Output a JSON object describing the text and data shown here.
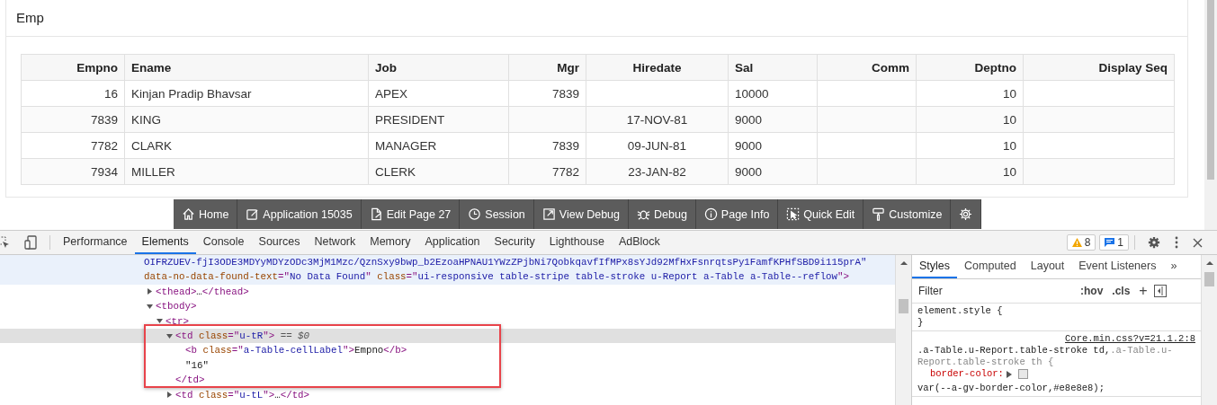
{
  "region": {
    "title": "Emp"
  },
  "table": {
    "columns": [
      "Empno",
      "Ename",
      "Job",
      "Mgr",
      "Hiredate",
      "Sal",
      "Comm",
      "Deptno",
      "Display Seq"
    ],
    "rows": [
      [
        "16",
        "Kinjan Pradip Bhavsar",
        "APEX",
        "7839",
        "",
        "10000",
        "",
        "10",
        ""
      ],
      [
        "7839",
        "KING",
        "PRESIDENT",
        "",
        "17-NOV-81",
        "9000",
        "",
        "10",
        ""
      ],
      [
        "7782",
        "CLARK",
        "MANAGER",
        "7839",
        "09-JUN-81",
        "9000",
        "",
        "10",
        ""
      ],
      [
        "7934",
        "MILLER",
        "CLERK",
        "7782",
        "23-JAN-82",
        "9000",
        "",
        "10",
        ""
      ]
    ]
  },
  "debug_toolbar": [
    "Home",
    "Application 15035",
    "Edit Page 27",
    "Session",
    "View Debug",
    "Debug",
    "Page Info",
    "Quick Edit",
    "Customize"
  ],
  "devtools": {
    "tabs": [
      {
        "label": "Performance",
        "selected": false
      },
      {
        "label": "Elements",
        "selected": true
      },
      {
        "label": "Console",
        "selected": false
      },
      {
        "label": "Sources",
        "selected": false
      },
      {
        "label": "Network",
        "selected": false
      },
      {
        "label": "Memory",
        "selected": false
      },
      {
        "label": "Application",
        "selected": false
      },
      {
        "label": "Security",
        "selected": false
      },
      {
        "label": "Lighthouse",
        "selected": false
      },
      {
        "label": "AdBlock",
        "selected": false
      }
    ],
    "warnings": "8",
    "messages": "1",
    "dom": {
      "hovered": true,
      "lines": [
        [
          {
            "kind": "value",
            "s": "OIFRZUEV-fjI3ODE3MDYyMDYzODc3MjM1Mzc/QznSxy9bwp_b2EzoaHPNAU1YWzZPjbNi7QobkqavfIfMPx8sYJd92MfHxFsnrqtsPy1FamfKPHfSBD9i115prA\""
          }
        ],
        [
          {
            "kind": "attr",
            "s": "data-no-data-found-text"
          },
          {
            "kind": "tag",
            "s": "=\""
          },
          {
            "kind": "value",
            "s": "No Data Found"
          },
          {
            "kind": "tag",
            "s": "\" "
          },
          {
            "kind": "attr",
            "s": "class"
          },
          {
            "kind": "tag",
            "s": "=\""
          },
          {
            "kind": "value",
            "s": "ui-responsive table-stripe table-stroke u-Report a-Table a-Table--reflow"
          },
          {
            "kind": "tag",
            "s": "\">"
          }
        ]
      ],
      "children": [
        {
          "expanded": false,
          "selected": false,
          "lines": [
            [
              {
                "kind": "tag",
                "s": "<thead>"
              },
              {
                "kind": "text",
                "s": "…"
              },
              {
                "kind": "tag",
                "s": "</thead>"
              }
            ]
          ]
        },
        {
          "expanded": true,
          "selected": false,
          "lines": [
            [
              {
                "kind": "tag",
                "s": "<tbody>"
              }
            ]
          ],
          "children": [
            {
              "expanded": true,
              "selected": false,
              "lines": [
                [
                  {
                    "kind": "tag",
                    "s": "<tr>"
                  }
                ]
              ],
              "children": [
                {
                  "expanded": true,
                  "selected": true,
                  "lines": [
                    [
                      {
                        "kind": "tag",
                        "s": "<td "
                      },
                      {
                        "kind": "attr",
                        "s": "class"
                      },
                      {
                        "kind": "tag",
                        "s": "=\""
                      },
                      {
                        "kind": "value",
                        "s": "u-tR"
                      },
                      {
                        "kind": "tag",
                        "s": "\">"
                      },
                      {
                        "kind": "dim",
                        "s": " == $0"
                      }
                    ]
                  ],
                  "close": [
                    [
                      {
                        "kind": "tag",
                        "s": "</td>"
                      }
                    ]
                  ],
                  "children": [
                    {
                      "selected": false,
                      "lines": [
                        [
                          {
                            "kind": "tag",
                            "s": "<b "
                          },
                          {
                            "kind": "attr",
                            "s": "class"
                          },
                          {
                            "kind": "tag",
                            "s": "=\""
                          },
                          {
                            "kind": "value",
                            "s": "a-Table-cellLabel"
                          },
                          {
                            "kind": "tag",
                            "s": "\">"
                          },
                          {
                            "kind": "text",
                            "s": "Empno"
                          },
                          {
                            "kind": "tag",
                            "s": "</b>"
                          }
                        ]
                      ]
                    },
                    {
                      "selected": false,
                      "lines": [
                        [
                          {
                            "kind": "text",
                            "s": "\"16\""
                          }
                        ]
                      ]
                    }
                  ]
                },
                {
                  "expanded": false,
                  "selected": false,
                  "lines": [
                    [
                      {
                        "kind": "tag",
                        "s": "<td "
                      },
                      {
                        "kind": "attr",
                        "s": "class"
                      },
                      {
                        "kind": "tag",
                        "s": "=\""
                      },
                      {
                        "kind": "value",
                        "s": "u-tL"
                      },
                      {
                        "kind": "tag",
                        "s": "\">"
                      },
                      {
                        "kind": "text",
                        "s": "…"
                      },
                      {
                        "kind": "tag",
                        "s": "</td>"
                      }
                    ]
                  ]
                }
              ]
            }
          ]
        }
      ]
    },
    "side_tabs": [
      {
        "label": "Styles",
        "selected": true
      },
      {
        "label": "Computed",
        "selected": false
      },
      {
        "label": "Layout",
        "selected": false
      },
      {
        "label": "Event Listeners",
        "selected": false
      }
    ],
    "more": "»",
    "filter": {
      "placeholder": "Filter"
    },
    "hov": ":hov",
    "cls": ".cls",
    "plus": "+",
    "rules": [
      {
        "selector": "element.style {",
        "close": "}"
      },
      {
        "selector": ".a-Table.u-Report.table-stroke td,",
        "selector_dim": ".a-Table.u-Report.table-stroke th {",
        "source": "Core.min.css?v=21.1.2:8",
        "decls": [
          {
            "prop": "border-color:",
            "value": "var(--a-gv-border-color,#e8e8e8);"
          }
        ]
      }
    ]
  }
}
